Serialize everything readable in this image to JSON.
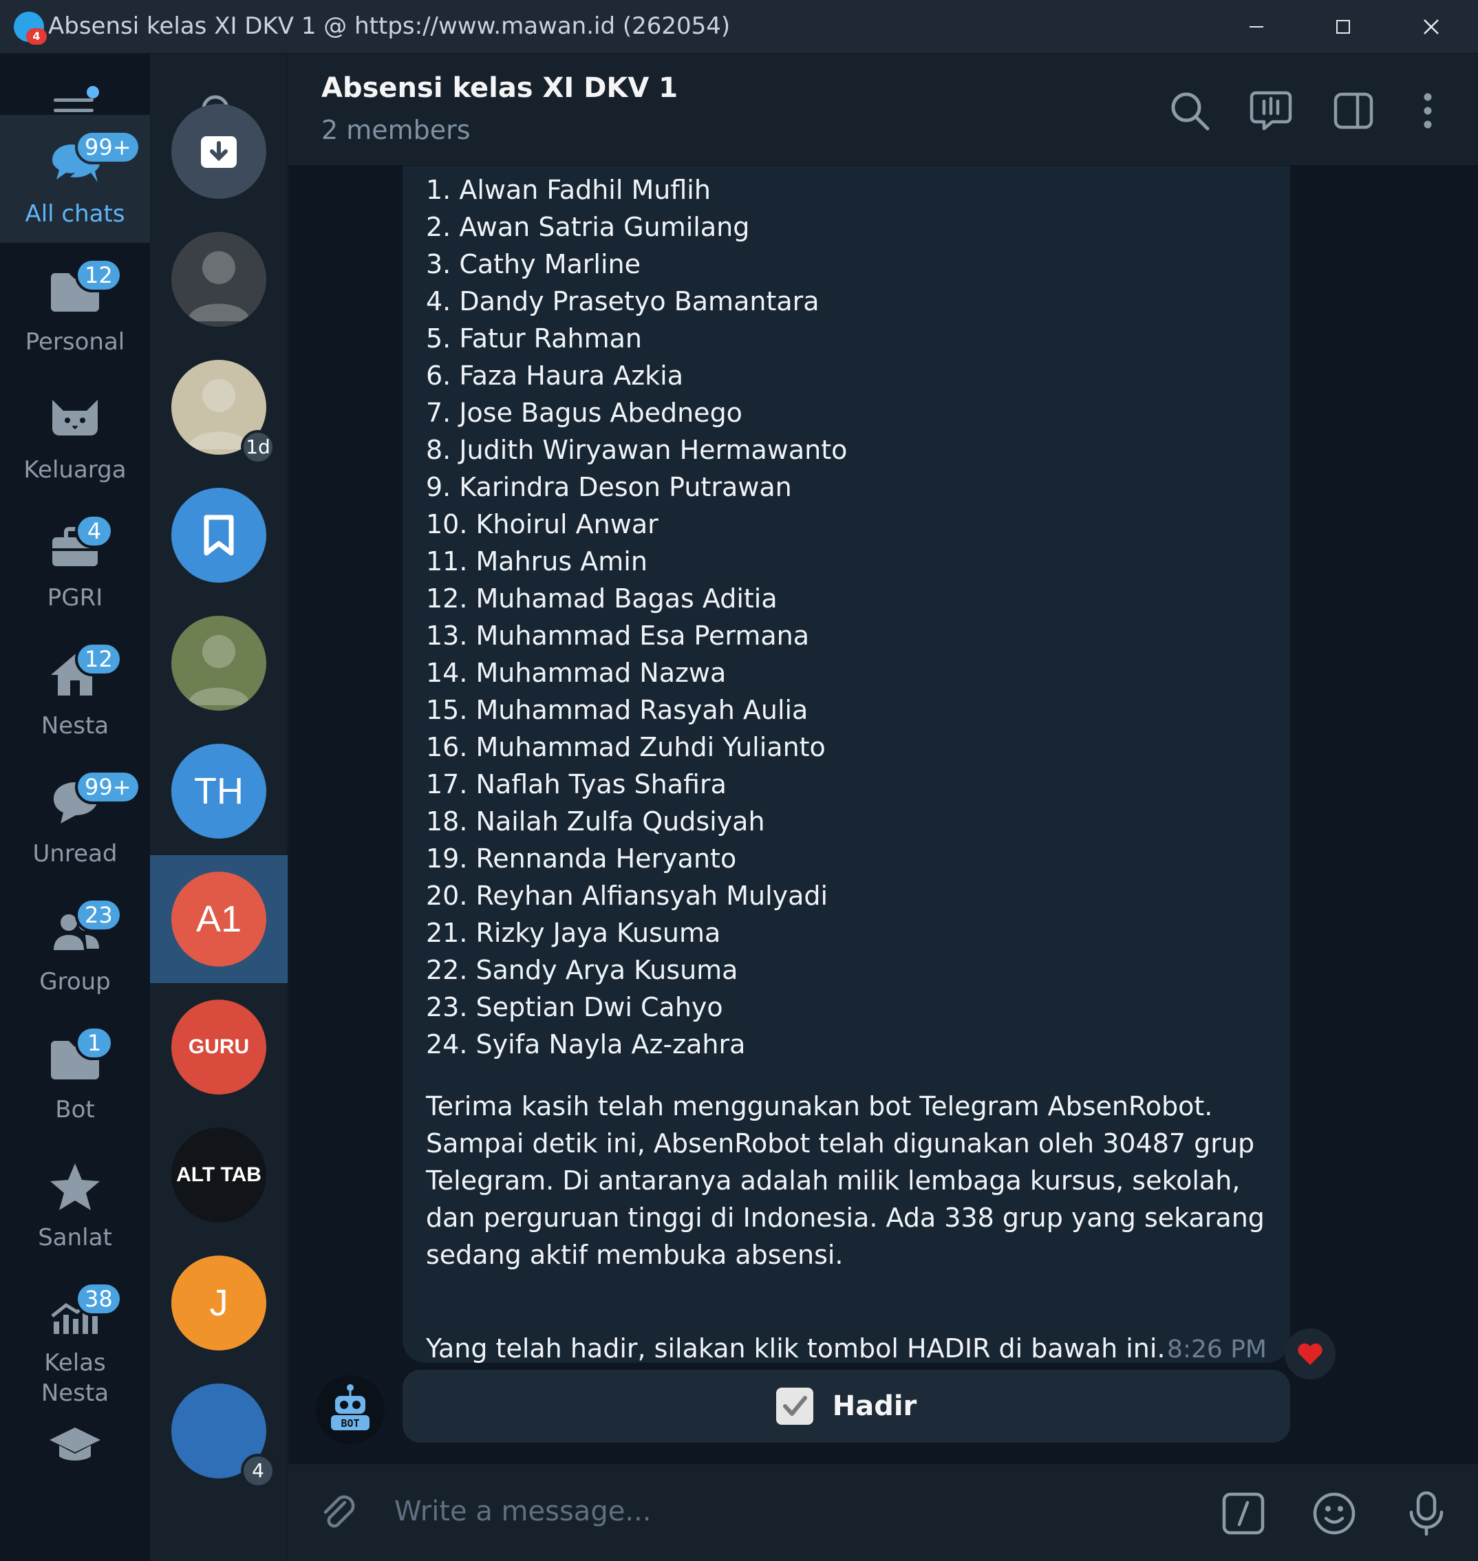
{
  "window": {
    "title": "Absensi kelas XI DKV 1 @ https://www.mawan.id (262054)",
    "icon_badge": "4",
    "minimize": "—",
    "maximize": "☐",
    "close": "✕"
  },
  "folders": [
    {
      "name": "folder-all-chats",
      "label": "All chats",
      "badge": "99+",
      "icon": "chats-icon",
      "active": true
    },
    {
      "name": "folder-personal",
      "label": "Personal",
      "badge": "12",
      "icon": "folder-icon"
    },
    {
      "name": "folder-keluarga",
      "label": "Keluarga",
      "badge": "",
      "icon": "cat-icon"
    },
    {
      "name": "folder-pgri",
      "label": "PGRI",
      "badge": "4",
      "icon": "briefcase-icon"
    },
    {
      "name": "folder-nesta",
      "label": "Nesta",
      "badge": "12",
      "icon": "home-icon"
    },
    {
      "name": "folder-unread",
      "label": "Unread",
      "badge": "99+",
      "icon": "chat-icon"
    },
    {
      "name": "folder-group",
      "label": "Group",
      "badge": "23",
      "icon": "group-icon"
    },
    {
      "name": "folder-bot",
      "label": "Bot",
      "badge": "1",
      "icon": "folder-icon"
    },
    {
      "name": "folder-sanlat",
      "label": "Sanlat",
      "badge": "",
      "icon": "star-icon"
    },
    {
      "name": "folder-kelas-nesta",
      "label": "Kelas\nNesta",
      "badge": "38",
      "icon": "stats-icon"
    },
    {
      "name": "folder-edu",
      "label": "",
      "badge": "",
      "icon": "graduation-cap-icon"
    }
  ],
  "chats": [
    {
      "kind": "archive",
      "initials": "",
      "color": "#3d4b5c"
    },
    {
      "kind": "photo",
      "initials": "",
      "color": "#3a4046"
    },
    {
      "kind": "photo",
      "initials": "",
      "color": "#c9c2a8",
      "badge": "1d"
    },
    {
      "kind": "saved",
      "initials": "",
      "color": "#3d8fd9"
    },
    {
      "kind": "photo",
      "initials": "",
      "color": "#6e7f52"
    },
    {
      "kind": "initials",
      "initials": "TH",
      "color": "#3d8fd9"
    },
    {
      "kind": "initials",
      "initials": "A1",
      "color": "#e05a47",
      "active": true
    },
    {
      "kind": "logo",
      "initials": "GURU",
      "color": "#d94b3c"
    },
    {
      "kind": "logo",
      "initials": "ALT TAB",
      "color": "#111418"
    },
    {
      "kind": "initials",
      "initials": "J",
      "color": "#f0932b"
    },
    {
      "kind": "logo",
      "initials": "",
      "color": "#2f6fb8",
      "badge": "4"
    }
  ],
  "header": {
    "title": "Absensi kelas XI DKV 1",
    "subtitle": "2 members"
  },
  "message": {
    "names": [
      "1. Alwan Fadhil Muflih",
      "2. Awan Satria Gumilang",
      "3. Cathy Marline",
      "4. Dandy Prasetyo Bamantara",
      "5. Fatur Rahman",
      "6. Faza Haura Azkia",
      "7. Jose Bagus Abednego",
      "8. Judith Wiryawan Hermawanto",
      "9. Karindra Deson Putrawan",
      "10. Khoirul Anwar",
      "11. Mahrus Amin",
      "12. Muhamad Bagas Aditia",
      "13. Muhammad Esa Permana",
      "14. Muhammad Nazwa",
      "15. Muhammad Rasyah Aulia",
      "16. Muhammad Zuhdi Yulianto",
      "17. Naflah Tyas Shafira",
      "18. Nailah Zulfa Qudsiyah",
      "19. Rennanda Heryanto",
      "20. Reyhan Alfiansyah Mulyadi",
      "21. Rizky Jaya Kusuma",
      "22. Sandy Arya Kusuma",
      "23. Septian Dwi Cahyo",
      "24. Syifa Nayla Az-zahra"
    ],
    "body": "Terima kasih telah menggunakan bot Telegram AbsenRobot. Sampai detik ini, AbsenRobot telah digunakan oleh 30487 grup Telegram. Di antaranya adalah milik lembaga kursus, sekolah, dan perguruan tinggi di Indonesia. Ada 338 grup yang sekarang sedang aktif membuka absensi.",
    "last_line": "Yang telah hadir, silakan klik tombol HADIR di bawah ini.",
    "time": "8:26 PM",
    "reaction": "❤️",
    "bot_avatar_label": "BOT"
  },
  "keyboard": {
    "button_label": "Hadir"
  },
  "composer": {
    "placeholder": "Write a message..."
  },
  "colors": {
    "accent": "#5eb5f7",
    "bg": "#0e1621",
    "panel": "#17212b",
    "bubble": "#182533"
  }
}
